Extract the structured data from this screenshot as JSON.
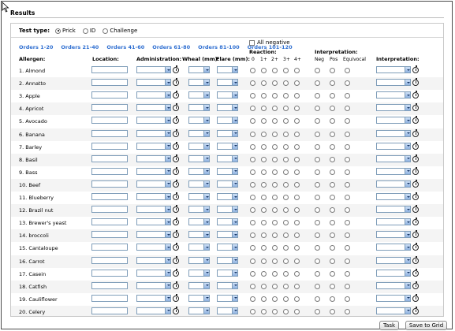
{
  "results_title": "Results",
  "test_type": {
    "label": "Test type:",
    "options": [
      "Prick",
      "ID",
      "Challenge"
    ],
    "selected": "Prick"
  },
  "tabs": [
    "Orders 1-20",
    "Orders 21-40",
    "Orders 41-60",
    "Orders 61-80",
    "Orders 81-100",
    "Orders 101-120"
  ],
  "all_negative_label": "All negative",
  "headers": {
    "allergen": "Allergen:",
    "location": "Location:",
    "administration": "Administration:",
    "wheal": "Wheal (mm):",
    "flare": "Flare (mm):",
    "reaction": "Reaction:",
    "interpretation": "Interpretation:",
    "interpretation2": "Interpretation:"
  },
  "reaction_levels": [
    "0",
    "1+",
    "2+",
    "3+",
    "4+"
  ],
  "interpretation_levels": [
    "Neg",
    "Pos",
    "Equivocal"
  ],
  "allergens": [
    "1. Almond",
    "2. Annatto",
    "3. Apple",
    "4. Apricot",
    "5. Avocado",
    "6. Banana",
    "7. Barley",
    "8. Basil",
    "9. Bass",
    "10. Beef",
    "11. Blueberry",
    "12. Brazil nut",
    "13. Brewer's yeast",
    "14. broccoli",
    "15. Cantaloupe",
    "16. Carrot",
    "17. Casein",
    "18. Catfish",
    "19. Cauliflower",
    "20. Celery"
  ],
  "buttons": {
    "task": "Task",
    "save_to_grid": "Save to Grid"
  }
}
